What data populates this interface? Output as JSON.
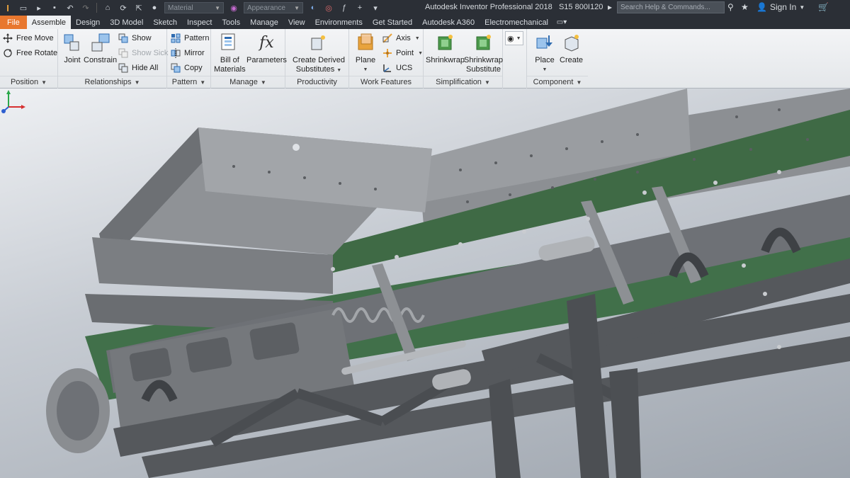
{
  "app": {
    "title": "Autodesk Inventor Professional 2018",
    "file_name": "S15 800I120",
    "search_placeholder": "Search Help & Commands...",
    "sign_in": "Sign In",
    "material_combo": "Material",
    "appearance_combo": "Appearance"
  },
  "tabs": [
    {
      "label": "File"
    },
    {
      "label": "Assemble"
    },
    {
      "label": "Design"
    },
    {
      "label": "3D Model"
    },
    {
      "label": "Sketch"
    },
    {
      "label": "Inspect"
    },
    {
      "label": "Tools"
    },
    {
      "label": "Manage"
    },
    {
      "label": "View"
    },
    {
      "label": "Environments"
    },
    {
      "label": "Get Started"
    },
    {
      "label": "Autodesk A360"
    },
    {
      "label": "Electromechanical"
    }
  ],
  "ribbon": {
    "position": {
      "title": "Position",
      "free_move": "Free Move",
      "free_rotate": "Free Rotate"
    },
    "relationships": {
      "title": "Relationships",
      "joint": "Joint",
      "constrain": "Constrain",
      "show": "Show",
      "show_sick": "Show Sick",
      "hide_all": "Hide All"
    },
    "pattern": {
      "title": "Pattern",
      "pattern": "Pattern",
      "mirror": "Mirror",
      "copy": "Copy"
    },
    "manage": {
      "title": "Manage",
      "bom_line1": "Bill of",
      "bom_line2": "Materials",
      "parameters": "Parameters"
    },
    "productivity": {
      "title": "Productivity",
      "derived_line1": "Create Derived",
      "derived_line2": "Substitutes"
    },
    "work_features": {
      "title": "Work Features",
      "plane": "Plane",
      "axis": "Axis",
      "point": "Point",
      "ucs": "UCS"
    },
    "simplification": {
      "title": "Simplification",
      "shrinkwrap": "Shrinkwrap",
      "shrinkwrap_sub_line1": "Shrinkwrap",
      "shrinkwrap_sub_line2": "Substitute"
    },
    "component": {
      "title": "Component",
      "place": "Place",
      "create": "Create"
    }
  },
  "colors": {
    "file_tab": "#e8772e",
    "titlebar": "#2b2f36",
    "belt": "#3f6a45",
    "frame": "#5e6064"
  },
  "icons": [
    "home-icon",
    "new-icon",
    "open-icon",
    "save-icon",
    "undo-icon",
    "redo-icon",
    "cart-icon",
    "star-icon",
    "user-icon"
  ]
}
